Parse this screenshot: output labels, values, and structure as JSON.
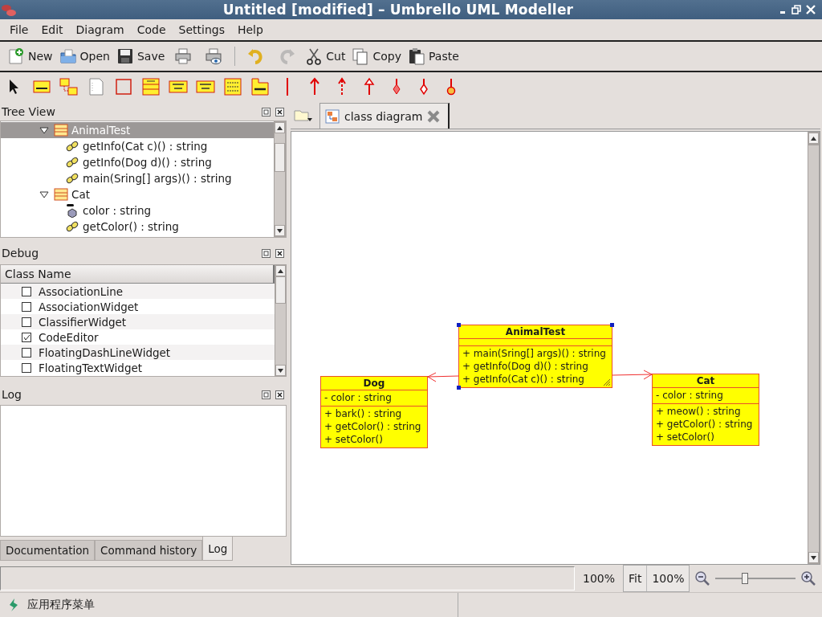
{
  "window": {
    "title": "Untitled [modified] – Umbrello UML Modeller"
  },
  "menu": [
    "File",
    "Edit",
    "Diagram",
    "Code",
    "Settings",
    "Help"
  ],
  "toolbar": [
    {
      "kind": "new",
      "label": "New",
      "disabled": false
    },
    {
      "kind": "open",
      "label": "Open",
      "disabled": false
    },
    {
      "kind": "save",
      "label": "Save",
      "disabled": false
    },
    {
      "kind": "print",
      "disabled": false
    },
    {
      "kind": "print-preview",
      "disabled": false
    },
    {
      "kind": "undo",
      "disabled": false
    },
    {
      "kind": "redo",
      "disabled": true
    },
    {
      "kind": "cut",
      "label": "Cut",
      "disabled": false
    },
    {
      "kind": "copy",
      "label": "Copy",
      "disabled": false
    },
    {
      "kind": "paste",
      "label": "Paste",
      "disabled": false
    }
  ],
  "uml_tools": [
    {
      "kind": "pointer"
    },
    {
      "kind": "class"
    },
    {
      "kind": "class-link"
    },
    {
      "kind": "note"
    },
    {
      "kind": "box"
    },
    {
      "kind": "entity"
    },
    {
      "kind": "interface"
    },
    {
      "kind": "datatype"
    },
    {
      "kind": "enum"
    },
    {
      "kind": "package"
    },
    {
      "kind": "anchor"
    },
    {
      "kind": "association"
    },
    {
      "kind": "dependency"
    },
    {
      "kind": "generalization"
    },
    {
      "kind": "composition"
    },
    {
      "kind": "aggregation"
    },
    {
      "kind": "containment"
    }
  ],
  "tree_view": {
    "title": "Tree View",
    "items": [
      {
        "kind": "class",
        "label": "AnimalTest",
        "expanded": true,
        "selected": true,
        "children": [
          {
            "kind": "operation",
            "label": "getInfo(Cat c)() : string",
            "selected": false
          },
          {
            "kind": "operation",
            "label": "getInfo(Dog d)() : string",
            "selected": false
          },
          {
            "kind": "operation",
            "label": "main(Sring[] args)() : string",
            "selected": false
          }
        ]
      },
      {
        "kind": "class",
        "label": "Cat",
        "expanded": true,
        "selected": false,
        "children": [
          {
            "kind": "attribute",
            "label": "color : string",
            "selected": false
          },
          {
            "kind": "operation",
            "label": "getColor() : string",
            "selected": false
          }
        ]
      }
    ]
  },
  "debug": {
    "title": "Debug",
    "columns": [
      "Class Name"
    ],
    "rows": [
      {
        "name": "AssociationLine",
        "checked": false
      },
      {
        "name": "AssociationWidget",
        "checked": false
      },
      {
        "name": "ClassifierWidget",
        "checked": false
      },
      {
        "name": "CodeEditor",
        "checked": true
      },
      {
        "name": "FloatingDashLineWidget",
        "checked": false
      },
      {
        "name": "FloatingTextWidget",
        "checked": false
      }
    ]
  },
  "log": {
    "title": "Log",
    "tabs": [
      {
        "label": "Documentation",
        "selected": false
      },
      {
        "label": "Command history",
        "selected": false
      },
      {
        "label": "Log",
        "selected": true
      }
    ]
  },
  "diagram": {
    "tabs": [
      {
        "label": "class diagram",
        "selected": true
      }
    ],
    "classes": [
      {
        "name": "AnimalTest",
        "selected": true,
        "incoming_arrow": false,
        "operations": [
          "+ main(Sring[] args)() : string",
          "+ getInfo(Dog d)() : string",
          "+ getInfo(Cat c)() : string"
        ]
      },
      {
        "name": "Dog",
        "selected": false,
        "incoming_arrow": true,
        "attributes": [
          "- color : string"
        ],
        "operations": [
          "+ bark() : string",
          "+ getColor() : string",
          "+ setColor()"
        ]
      },
      {
        "name": "Cat",
        "selected": false,
        "incoming_arrow": true,
        "attributes": [
          "- color : string"
        ],
        "operations": [
          "+ meow() : string",
          "+ getColor() : string",
          "+ setColor()"
        ]
      }
    ]
  },
  "status_bar": {
    "zoom_text": "100%",
    "fit_button": "Fit",
    "zoom_field": "100%",
    "zoom_slider": {
      "level": 0.35
    }
  },
  "taskbar": {
    "menu_label": "应用程序菜单"
  }
}
